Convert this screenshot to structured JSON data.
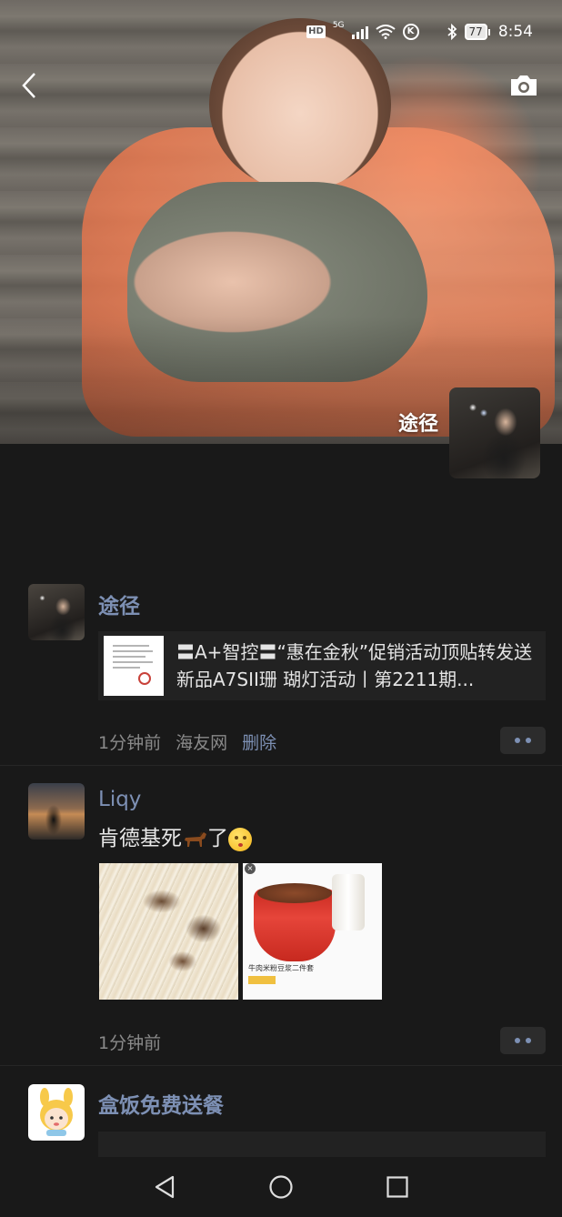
{
  "status_bar": {
    "hd": "HD",
    "network": "5G",
    "battery": "77",
    "time": "8:54"
  },
  "cover": {
    "profile_name": "途径",
    "back_icon": "chevron-left-icon",
    "camera_icon": "camera-icon"
  },
  "posts": [
    {
      "author": "途径",
      "link_title": "〓A+智控〓“惠在金秋”促销活动顶贴转发送新品A7SII珊 瑚灯活动丨第2211期...",
      "time": "1分钟前",
      "source": "海友网",
      "delete_label": "删除"
    },
    {
      "author": "Liqy",
      "text_before": "肯德基死",
      "text_after": "了",
      "emojis": [
        "horse-icon",
        "kissing-face-icon"
      ],
      "images": [
        "noodle-photo",
        "bowl-promo-photo"
      ],
      "promo_caption": "牛肉米粉豆浆二件套",
      "time": "1分钟前"
    },
    {
      "author": "盒饭免费送餐"
    }
  ],
  "nav": {
    "back": "nav-back-icon",
    "home": "nav-home-icon",
    "recents": "nav-recents-icon"
  },
  "colors": {
    "background": "#191919",
    "name_blue": "#7d90b4",
    "card_bg": "#222222"
  }
}
